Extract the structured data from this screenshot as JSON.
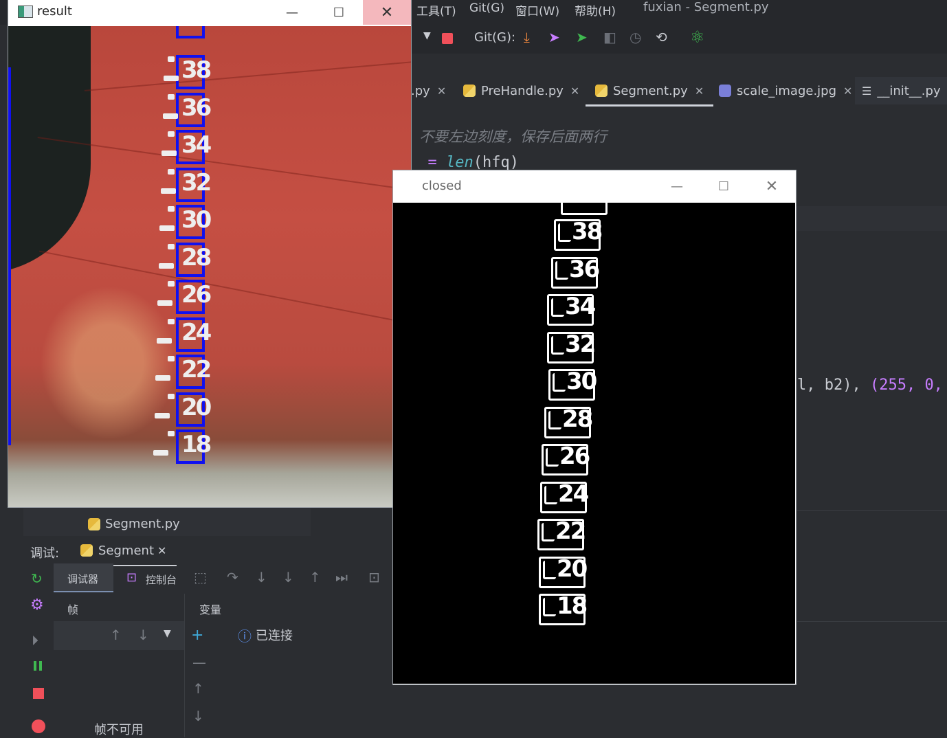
{
  "ide": {
    "menu": [
      "工具(T)",
      "Git(G)",
      "窗口(W)",
      "帮助(H)"
    ],
    "title": "fuxian - Segment.py",
    "git_label": "Git(G):",
    "tabs": [
      {
        "label": ".py",
        "active": false
      },
      {
        "label": "PreHandle.py",
        "active": false
      },
      {
        "label": "Segment.py",
        "active": true
      },
      {
        "label": "scale_image.jpg",
        "active": false
      },
      {
        "label": "__init__.py",
        "active": false
      }
    ],
    "code": {
      "comment": "不要左边刻度，保存后面两行",
      "line2_prefix": "_ = ",
      "line2_func": "len",
      "line2_arg": "(hfq)",
      "line3_a": "l, b2), ",
      "line3_b": "(255, 0,"
    }
  },
  "debug": {
    "file_label": "Segment.py",
    "debug_label": "调试:",
    "session": "Segment",
    "tab_debugger": "调试器",
    "tab_console": "控制台",
    "frames_label": "帧",
    "variables_label": "变量",
    "connected": "已连接",
    "frames_unavailable": "帧不可用"
  },
  "windows": {
    "result": {
      "title": "result"
    },
    "closed": {
      "title": "closed"
    }
  },
  "result_labels": [
    "38",
    "36",
    "34",
    "32",
    "30",
    "28",
    "26",
    "24",
    "22",
    "20",
    "18"
  ],
  "closed_labels": [
    "38",
    "36",
    "34",
    "32",
    "30",
    "28",
    "26",
    "24",
    "22",
    "20",
    "18"
  ],
  "colors": {
    "bbox": "#1010f0",
    "accent_purple": "#c77dff",
    "run_green": "#3fb950",
    "stop_red": "#f0505a"
  }
}
